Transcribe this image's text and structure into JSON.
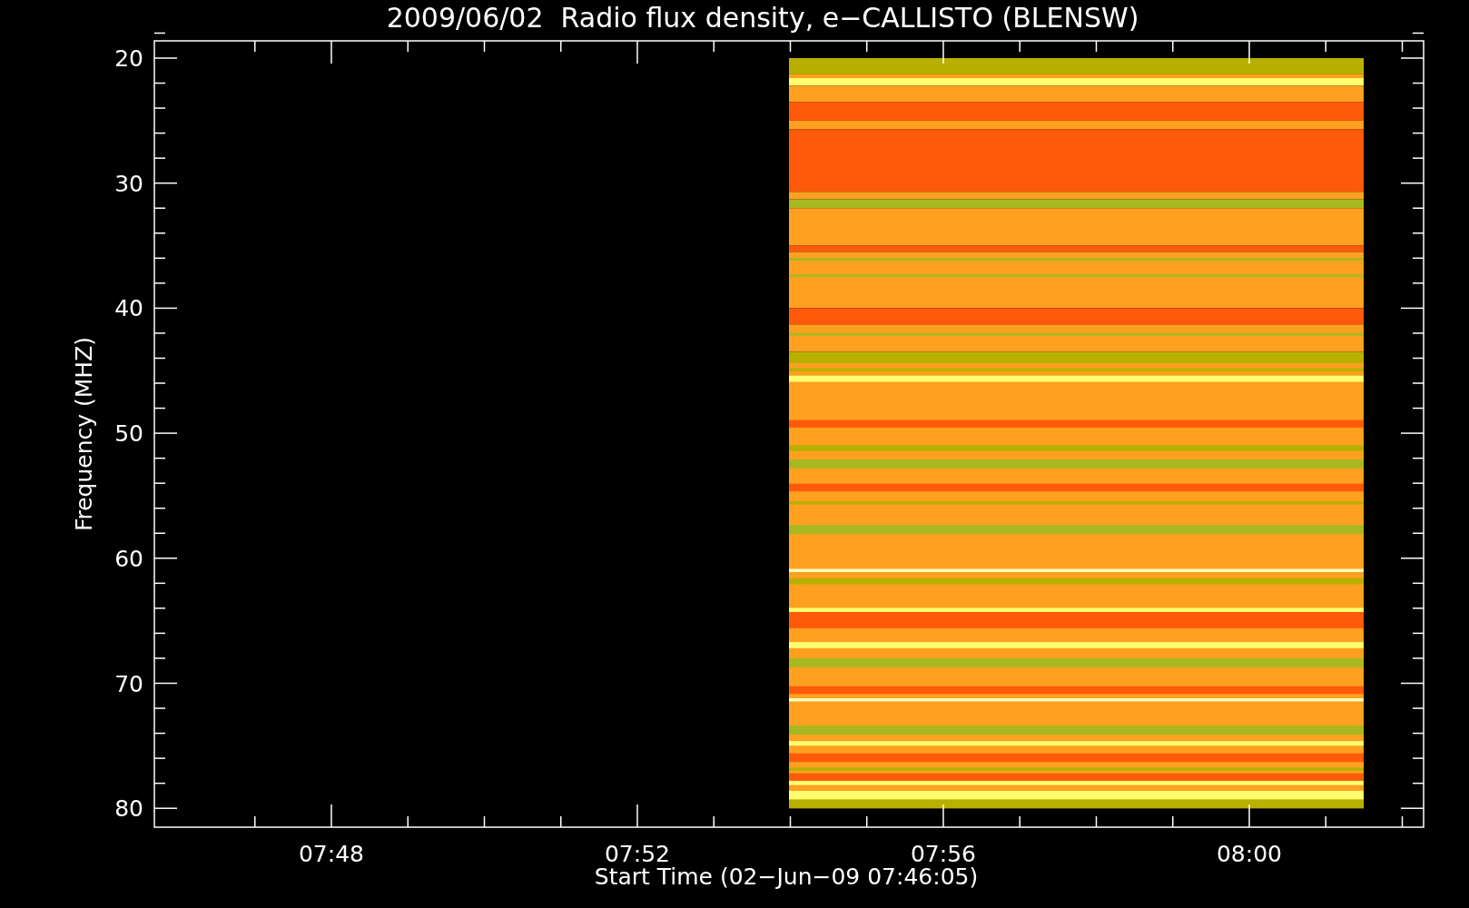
{
  "plot": {
    "title": "2009/06/02  Radio flux density, e−CALLISTO (BLENSW)",
    "xlabel": "Start Time (02−Jun−09 07:46:05)",
    "ylabel": "Frequency (MHZ)",
    "xtick_labels": [
      "07:48",
      "07:52",
      "07:56",
      "08:00"
    ],
    "ytick_labels": [
      "20",
      "30",
      "40",
      "50",
      "60",
      "70",
      "80"
    ]
  }
}
